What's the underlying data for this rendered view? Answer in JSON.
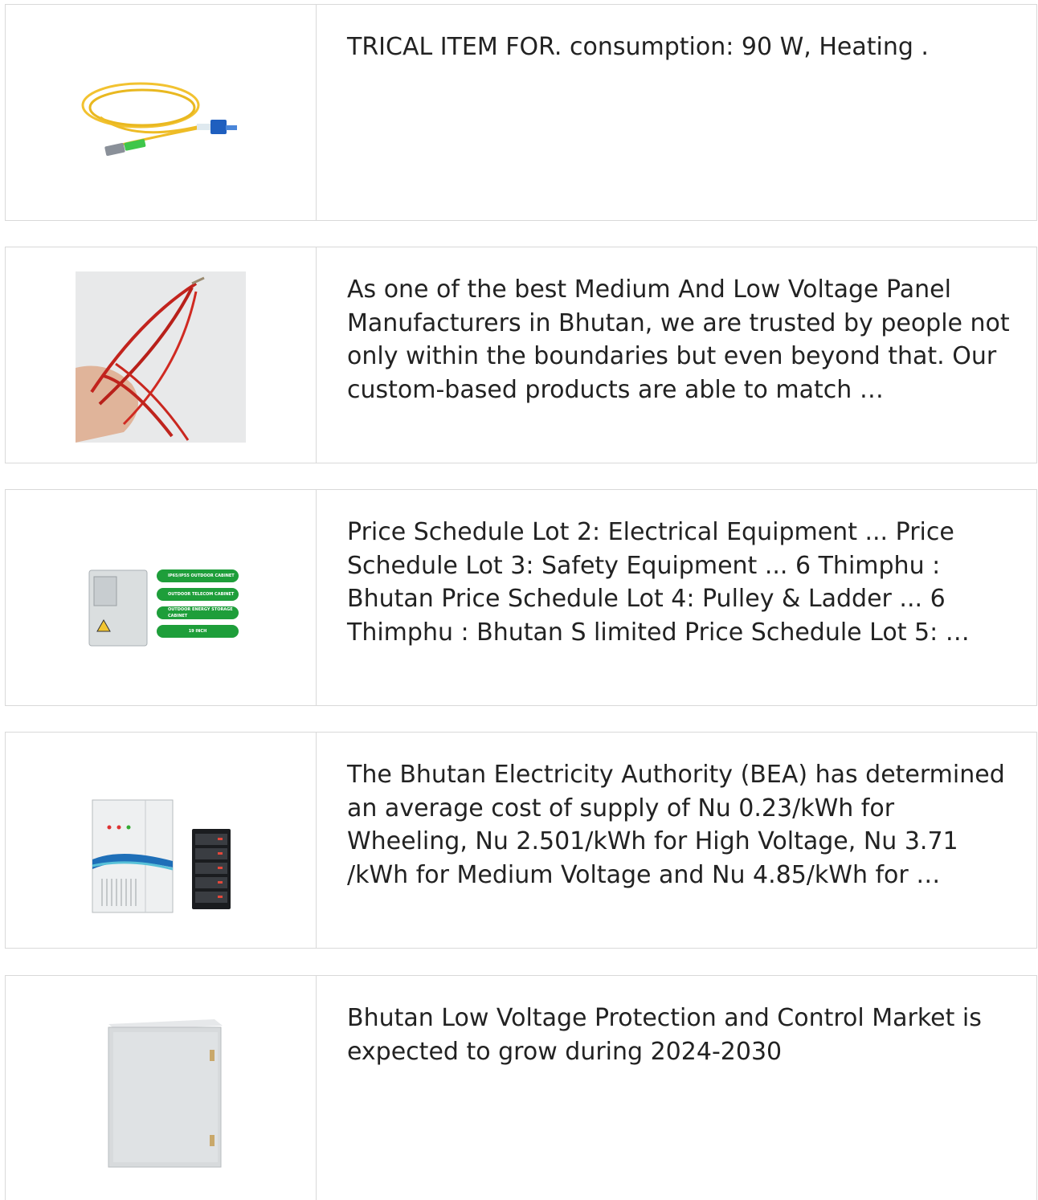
{
  "items": [
    {
      "image": "yellow-fiber-patch-cord",
      "text": "TRICAL ITEM FOR. consumption: 90 W, Heating ."
    },
    {
      "image": "red-heating-cable",
      "text": "As one of the best Medium And Low Voltage Panel Manufacturers in Bhutan, we are trusted by people not only within the boundaries but even beyond that. Our custom-based products are able to match …"
    },
    {
      "image": "outdoor-cabinet-with-labels",
      "text": "Price Schedule Lot 2: Electrical Equipment ... Price Schedule Lot 3: Safety Equipment ... 6 Thimphu : Bhutan Price Schedule Lot 4: Pulley & Ladder ... 6 Thimphu : Bhutan S limited Price Schedule Lot 5: …"
    },
    {
      "image": "energy-storage-cabinet-and-battery",
      "text": "The Bhutan Electricity Authority (BEA) has determined an average cost of supply of Nu 0.23/kWh for Wheeling, Nu 2.501/kWh for High Voltage, Nu 3.71 /kWh for Medium Voltage and Nu 4.85/kWh for …"
    },
    {
      "image": "steel-enclosure-box",
      "text": "Bhutan Low Voltage Protection and Control Market is expected to grow during 2024-2030"
    }
  ],
  "cabinet_labels": [
    "IP65/IP55 OUTDOOR CABINET",
    "OUTDOOR TELECOM CABINET",
    "OUTDOOR ENERGY STORAGE CABINET",
    "19 INCH"
  ],
  "colors": {
    "border": "#d9d9d9",
    "text": "#222222",
    "label_green": "#1e9e3a"
  }
}
